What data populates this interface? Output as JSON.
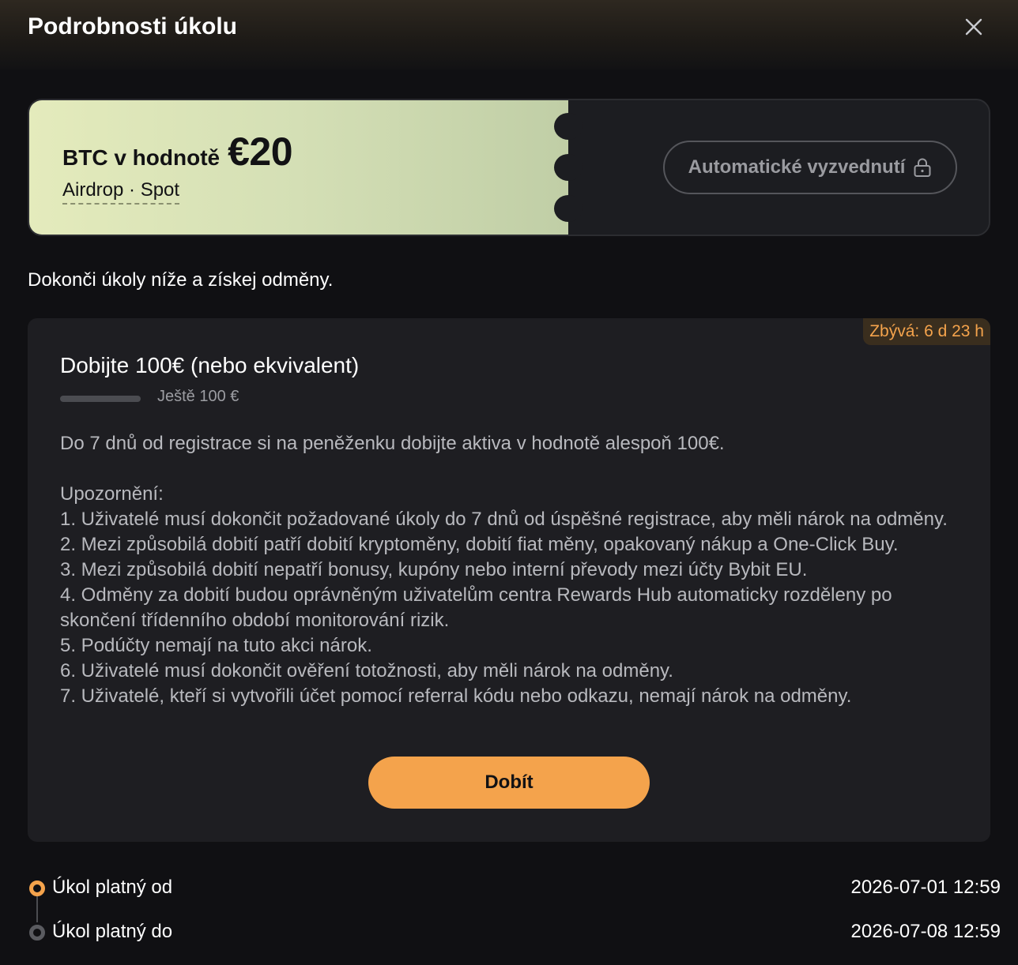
{
  "modal": {
    "title": "Podrobnosti úkolu",
    "close_icon": "close-icon"
  },
  "reward": {
    "prefix": "BTC v hodnotě",
    "amount": "€20",
    "tags": "Airdrop · Spot",
    "auto_claim_label": "Automatické vyzvednutí",
    "auto_claim_icon": "lock-icon"
  },
  "intro": "Dokonči úkoly níže a získej odměny.",
  "task": {
    "countdown": "Zbývá: 6 d 23 h",
    "title": "Dobijte 100€ (nebo ekvivalent)",
    "progress_fraction": 0,
    "progress_label": "Ještě 100 €",
    "description": "Do 7 dnů od registrace si na peněženku dobijte aktiva v hodnotě alespoň 100€.",
    "notice_heading": "Upozornění:",
    "notes": [
      "1. Uživatelé musí dokončit požadované úkoly do 7 dnů od úspěšné registrace, aby měli nárok na odměny.",
      "2. Mezi způsobilá dobití patří dobití kryptoměny, dobití fiat měny, opakovaný nákup a One-Click Buy.",
      "3. Mezi způsobilá dobití nepatří bonusy, kupóny nebo interní převody mezi účty Bybit EU.",
      "4. Odměny za dobití budou oprávněným uživatelům centra Rewards Hub automaticky rozděleny po skončení třídenního období monitorování rizik.",
      "5. Podúčty nemají na tuto akci nárok.",
      "6. Uživatelé musí dokončit ověření totožnosti, aby měli nárok na odměny.",
      "7. Uživatelé, kteří si vytvořili účet pomocí referral kódu nebo odkazu, nemají nárok na odměny."
    ],
    "button_label": "Dobít"
  },
  "validity": {
    "from_label": "Úkol platný od",
    "from_value": "2026-07-01 12:59",
    "to_label": "Úkol platný do",
    "to_value": "2026-07-08 12:59"
  },
  "colors": {
    "accent": "#f4a34c",
    "background": "#101013",
    "card": "#1e1e22",
    "coupon_start": "#e4ebbc",
    "coupon_end": "#c0cea6",
    "inactive_dot": "#5a5b60"
  }
}
